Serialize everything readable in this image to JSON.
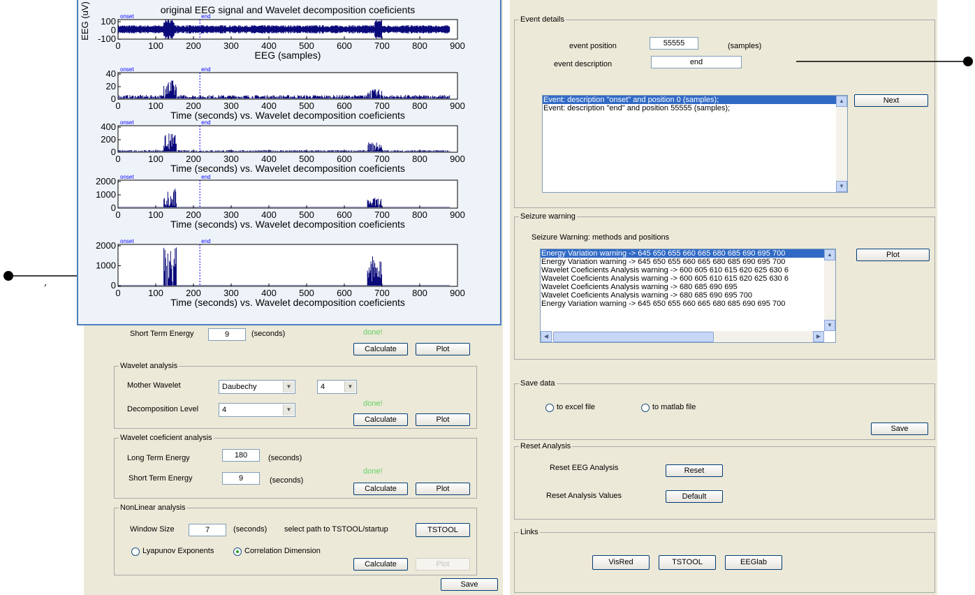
{
  "plot_window": {
    "title": "original EEG signal and Wavelet decomposition coeficients",
    "ylabel_first": "EEG (uV)",
    "xlabel_first": "EEG (samples)",
    "xlabel_other": "Time (seconds) vs. Wavelet decomposition coeficients",
    "xticks": [
      "0",
      "100",
      "200",
      "300",
      "400",
      "500",
      "600",
      "700",
      "800",
      "900"
    ],
    "marker_onset": "onset",
    "marker_end": "end",
    "subplots": [
      {
        "yticks": [
          "100",
          "0",
          "-100"
        ]
      },
      {
        "yticks": [
          "40",
          "20",
          "0"
        ]
      },
      {
        "yticks": [
          "400",
          "200",
          "0"
        ]
      },
      {
        "yticks": [
          "2000",
          "1000",
          "0"
        ]
      },
      {
        "yticks": [
          "2000",
          "1000",
          "0"
        ]
      }
    ]
  },
  "left_panel": {
    "ste_label": "Short Term Energy",
    "ste_value": "9",
    "ste_unit": "(seconds)",
    "ste_status": "done!",
    "calculate": "Calculate",
    "plot": "Plot",
    "wavelet_analysis": {
      "legend": "Wavelet analysis",
      "mother_label": "Mother Wavelet",
      "mother_value": "Daubechy",
      "order_value": "4",
      "level_label": "Decomposition Level",
      "level_value": "4",
      "status": "done!"
    },
    "coef_analysis": {
      "legend": "Wavelet coeficient analysis",
      "lte_label": "Long Term Energy",
      "lte_value": "180",
      "lte_unit": "(seconds)",
      "ste_label": "Short Term Energy",
      "ste_value": "9",
      "ste_unit": "(seconds)",
      "status": "done!"
    },
    "nonlinear": {
      "legend": "NonLinear analysis",
      "window_label": "Window Size",
      "window_value": "7",
      "window_unit": "(seconds)",
      "path_label": "select path to TSTOOL/startup",
      "tstool": "TSTOOL",
      "radio_lyap": "Lyapunov Exponents",
      "radio_corr": "Correlation Dimension"
    },
    "save": "Save"
  },
  "event_details": {
    "legend": "Event details",
    "pos_label": "event position",
    "pos_value": "55555",
    "pos_unit": "(samples)",
    "desc_label": "event description",
    "desc_value": "end",
    "list": [
      "Event: description \"onset\" and position 0 (samples);",
      "Event: description \"end\" and position 55555 (samples);"
    ],
    "next": "Next"
  },
  "seizure": {
    "legend": "Seizure warning",
    "subtitle": "Seizure Warning: methods and positions",
    "list": [
      "Energy Variation warning -> 645  650  655  660  665  680  685  690  695  700",
      "Energy Variation warning -> 645  650  655  660  665  680  685  690  695  700",
      "Wavelet Coeficients Analysis warning -> 600  605  610  615  620  625  630  6",
      "Wavelet Coeficients Analysis warning -> 600  605  610  615  620  625  630  6",
      "Wavelet Coeficients Analysis warning -> 680  685  690  695",
      "Wavelet Coeficients Analysis warning -> 680  685  690  695  700",
      "Energy Variation warning -> 645  650  655  660  665  680  685  690  695  700"
    ],
    "plot": "Plot"
  },
  "save_data": {
    "legend": "Save data",
    "excel": "to excel file",
    "matlab": "to matlab file",
    "save": "Save"
  },
  "reset": {
    "legend": "Reset Analysis",
    "eeg_label": "Reset EEG Analysis",
    "eeg_btn": "Reset",
    "values_label": "Reset Analysis Values",
    "values_btn": "Default"
  },
  "links": {
    "legend": "Links",
    "visred": "VisRed",
    "tstool": "TSTOOL",
    "eeglab": "EEGlab"
  }
}
